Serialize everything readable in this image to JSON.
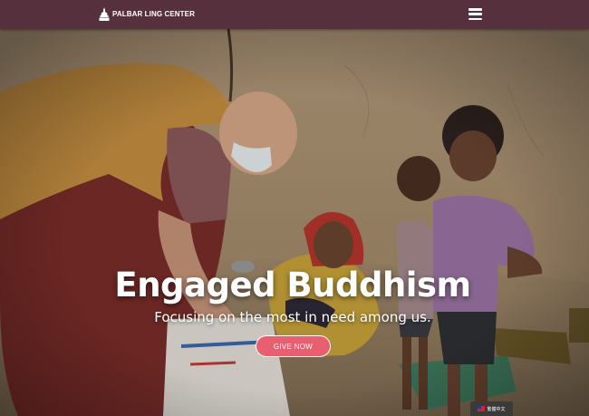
{
  "header": {
    "logo_text": "PALBAR LING CENTER",
    "menu_icon": "hamburger-menu-icon",
    "background_color": "#57303d"
  },
  "hero": {
    "title": "Engaged Buddhism",
    "subtitle": "Focusing on the most in need among us.",
    "cta_label": "GIVE NOW",
    "cta_color": "#e8606f"
  },
  "language_widget": {
    "label": "繁體中文",
    "icon": "taiwan-flag-icon"
  }
}
